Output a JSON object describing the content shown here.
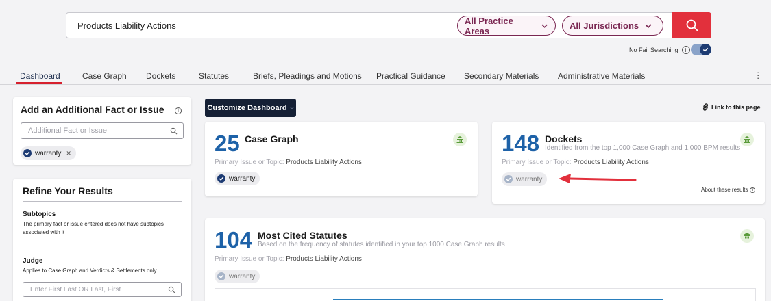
{
  "search": {
    "query": "Products Liability Actions",
    "practice_areas": "All Practice Areas",
    "jurisdictions": "All Jurisdictions",
    "no_fail_label": "No Fail Searching",
    "no_fail_enabled": true
  },
  "tabs": [
    {
      "label": "Dashboard",
      "active": true
    },
    {
      "label": "Case Graph"
    },
    {
      "label": "Dockets"
    },
    {
      "label": "Statutes"
    },
    {
      "label": "Briefs, Pleadings and Motions"
    },
    {
      "label": "Practical Guidance"
    },
    {
      "label": "Secondary Materials"
    },
    {
      "label": "Administrative Materials"
    }
  ],
  "add_fact": {
    "title": "Add an Additional Fact or Issue",
    "placeholder": "Additional Fact or Issue",
    "chip": "warranty"
  },
  "refine": {
    "title": "Refine Your Results",
    "subtopics_heading": "Subtopics",
    "subtopics_text": "The primary fact or issue entered does not have subtopics associated with it",
    "judge_heading": "Judge",
    "judge_text": "Applies to Case Graph and Verdicts & Settlements only",
    "judge_placeholder": "Enter First Last OR Last, First"
  },
  "toolbar": {
    "customize_label": "Customize Dashboard",
    "link_label": "Link to this page"
  },
  "cards": {
    "case_graph": {
      "count": "25",
      "title": "Case Graph",
      "topic_label": "Primary Issue or Topic:",
      "topic_value": "Products Liability Actions",
      "chip": "warranty"
    },
    "dockets": {
      "count": "148",
      "title": "Dockets",
      "subtitle": "Identified from the top 1,000 Case Graph and 1,000 BPM results",
      "topic_label": "Primary Issue or Topic:",
      "topic_value": "Products Liability Actions",
      "chip": "warranty",
      "about": "About these results"
    },
    "statutes": {
      "count": "104",
      "title": "Most Cited Statutes",
      "subtitle": "Based on the frequency of statutes identified in your top 1000 Case Graph results",
      "topic_label": "Primary Issue or Topic:",
      "topic_value": "Products Liability Actions",
      "chip": "warranty"
    }
  },
  "colors": {
    "accent_red": "#e2303c",
    "pill_maroon": "#7a2752",
    "number_blue": "#1e62a8",
    "navy": "#152035"
  }
}
